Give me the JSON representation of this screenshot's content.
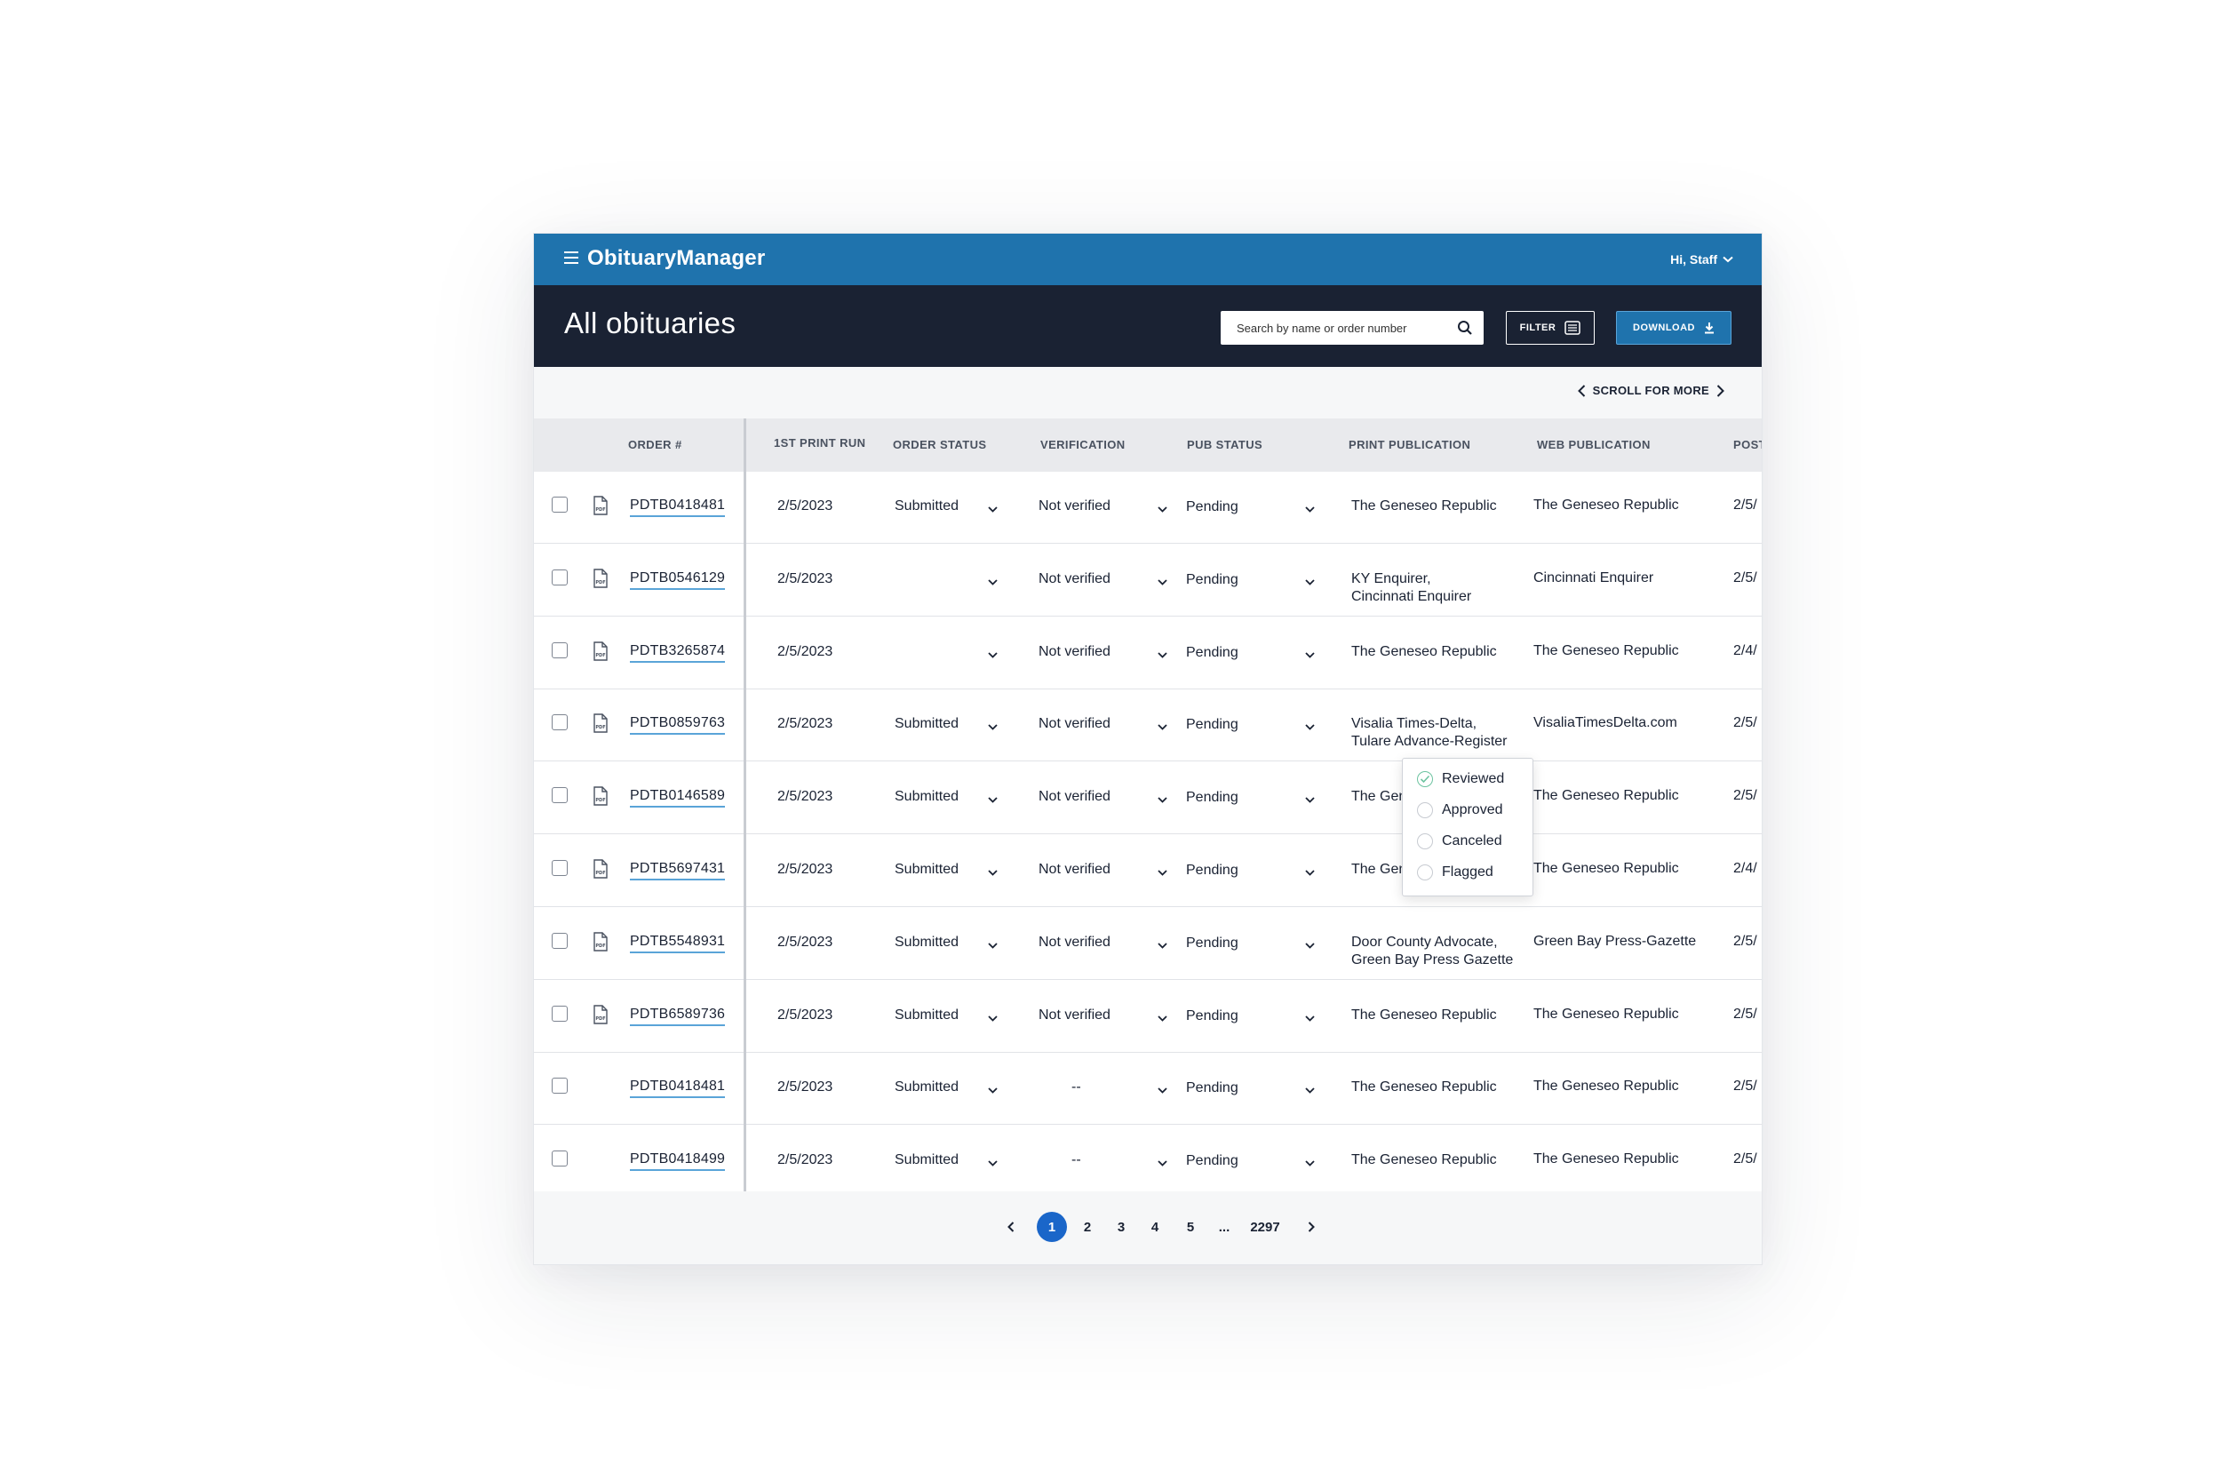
{
  "app": {
    "name": "ObituaryManager",
    "user_greeting": "Hi, Staff",
    "page_title": "All obituaries"
  },
  "search": {
    "placeholder": "Search by name or order number"
  },
  "toolbar": {
    "filter_label": "FILTER",
    "download_label": "DOWNLOAD"
  },
  "scroll_hint": "SCROLL FOR MORE",
  "colors": {
    "topbar": "#1f73ad",
    "header": "#1a2233",
    "accent": "#1a66c9",
    "link_underline": "#5aa4d8"
  },
  "columns": [
    "ORDER #",
    "1ST PRINT RUN",
    "ORDER STATUS",
    "VERIFICATION",
    "PUB STATUS",
    "PRINT PUBLICATION",
    "WEB PUBLICATION",
    "POST"
  ],
  "rows": [
    {
      "has_pdf": true,
      "order": "PDTB0418481",
      "print_run": "2/5/2023",
      "order_status": "Submitted",
      "verification": "Not verified",
      "pub_status": "Pending",
      "print_pub": [
        "The Geneseo Republic"
      ],
      "web_pub": "The Geneseo Republic",
      "post": "2/5/"
    },
    {
      "has_pdf": true,
      "order": "PDTB0546129",
      "print_run": "2/5/2023",
      "order_status": "",
      "verification": "Not verified",
      "pub_status": "Pending",
      "print_pub": [
        "KY Enquirer,",
        "Cincinnati Enquirer"
      ],
      "web_pub": "Cincinnati Enquirer",
      "post": "2/5/"
    },
    {
      "has_pdf": true,
      "order": "PDTB3265874",
      "print_run": "2/5/2023",
      "order_status": "",
      "verification": "Not verified",
      "pub_status": "Pending",
      "print_pub": [
        "The Geneseo Republic"
      ],
      "web_pub": "The Geneseo Republic",
      "post": "2/4/"
    },
    {
      "has_pdf": true,
      "order": "PDTB0859763",
      "print_run": "2/5/2023",
      "order_status": "Submitted",
      "verification": "Not verified",
      "pub_status": "Pending",
      "print_pub": [
        "Visalia Times-Delta,",
        "Tulare Advance-Register"
      ],
      "web_pub": "VisaliaTimesDelta.com",
      "post": "2/5/"
    },
    {
      "has_pdf": true,
      "order": "PDTB0146589",
      "print_run": "2/5/2023",
      "order_status": "Submitted",
      "verification": "Not verified",
      "pub_status": "Pending",
      "print_pub": [
        "The Geneseo Republic"
      ],
      "web_pub": "The Geneseo Republic",
      "post": "2/5/"
    },
    {
      "has_pdf": true,
      "order": "PDTB5697431",
      "print_run": "2/5/2023",
      "order_status": "Submitted",
      "verification": "Not verified",
      "pub_status": "Pending",
      "print_pub": [
        "The Geneseo Republic"
      ],
      "web_pub": "The Geneseo Republic",
      "post": "2/4/"
    },
    {
      "has_pdf": true,
      "order": "PDTB5548931",
      "print_run": "2/5/2023",
      "order_status": "Submitted",
      "verification": "Not verified",
      "pub_status": "Pending",
      "print_pub": [
        "Door County Advocate,",
        "Green Bay Press Gazette"
      ],
      "web_pub": "Green Bay Press-Gazette",
      "post": "2/5/"
    },
    {
      "has_pdf": true,
      "order": "PDTB6589736",
      "print_run": "2/5/2023",
      "order_status": "Submitted",
      "verification": "Not verified",
      "pub_status": "Pending",
      "print_pub": [
        "The Geneseo Republic"
      ],
      "web_pub": "The Geneseo Republic",
      "post": "2/5/"
    },
    {
      "has_pdf": false,
      "order": "PDTB0418481",
      "print_run": "2/5/2023",
      "order_status": "Submitted",
      "verification": "--",
      "pub_status": "Pending",
      "print_pub": [
        "The Geneseo Republic"
      ],
      "web_pub": "The Geneseo Republic",
      "post": "2/5/"
    },
    {
      "has_pdf": false,
      "order": "PDTB0418499",
      "print_run": "2/5/2023",
      "order_status": "Submitted",
      "verification": "--",
      "pub_status": "Pending",
      "print_pub": [
        "The Geneseo Republic"
      ],
      "web_pub": "The Geneseo Republic",
      "post": "2/5/"
    }
  ],
  "status_dropdown": {
    "options": [
      {
        "label": "Reviewed",
        "checked": true
      },
      {
        "label": "Approved",
        "checked": false
      },
      {
        "label": "Canceled",
        "checked": false
      },
      {
        "label": "Flagged",
        "checked": false
      }
    ]
  },
  "pagination": {
    "pages": [
      "1",
      "2",
      "3",
      "4",
      "5",
      "...",
      "2297"
    ],
    "current": "1"
  }
}
